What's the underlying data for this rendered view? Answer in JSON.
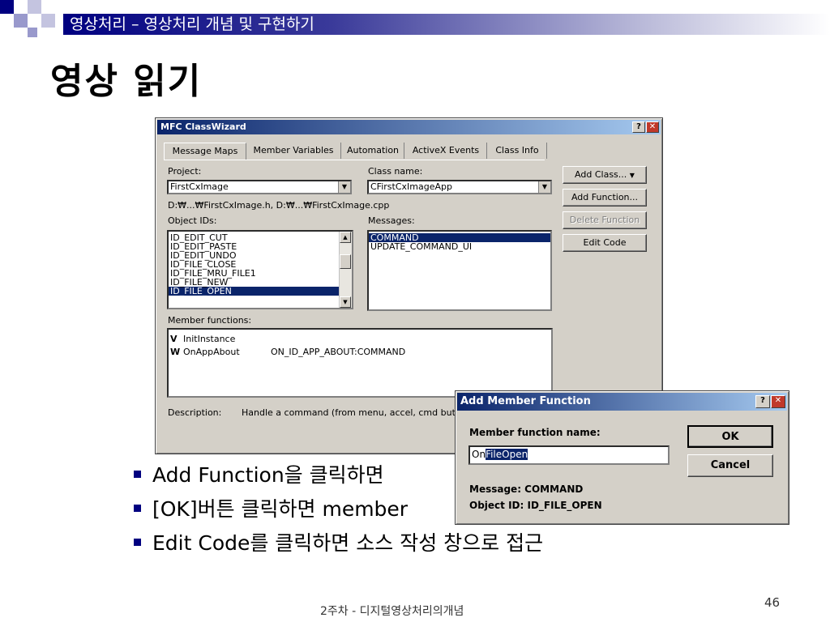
{
  "slide": {
    "header": "영상처리 – 영상처리 개념 및 구현하기",
    "title": "영상 읽기",
    "footer": "2주차 - 디지털영상처리의개념",
    "page_number": "46"
  },
  "classwizard": {
    "title": "MFC ClassWizard",
    "help_btn": "?",
    "close_btn": "✕",
    "tabs": [
      "Message Maps",
      "Member Variables",
      "Automation",
      "ActiveX Events",
      "Class Info"
    ],
    "project_label": "Project:",
    "project_value": "FirstCxImage",
    "class_label": "Class name:",
    "class_value": "CFirstCxImageApp",
    "path_text": "D:₩...₩FirstCxImage.h, D:₩...₩FirstCxImage.cpp",
    "object_ids_label": "Object IDs:",
    "object_ids": [
      "ID_EDIT_CUT",
      "ID_EDIT_PASTE",
      "ID_EDIT_UNDO",
      "ID_FILE_CLOSE",
      "ID_FILE_MRU_FILE1",
      "ID_FILE_NEW",
      "ID_FILE_OPEN"
    ],
    "messages_label": "Messages:",
    "messages": [
      "COMMAND",
      "UPDATE_COMMAND_UI"
    ],
    "member_functions_label": "Member functions:",
    "member_functions": [
      {
        "flag": "V",
        "name": "InitInstance",
        "map": ""
      },
      {
        "flag": "W",
        "name": "OnAppAbout",
        "map": "ON_ID_APP_ABOUT:COMMAND"
      }
    ],
    "description_label": "Description:",
    "description_text": "Handle a command (from menu, accel, cmd butto",
    "buttons": {
      "add_class": "Add Class...",
      "add_function": "Add Function...",
      "delete_function": "Delete Function",
      "edit_code": "Edit Code"
    }
  },
  "addmember": {
    "title": "Add Member Function",
    "help_btn": "?",
    "close_btn": "✕",
    "name_label": "Member function name:",
    "name_prefix": "On",
    "name_selected": "FileOpen",
    "ok": "OK",
    "cancel": "Cancel",
    "message": "Message: COMMAND",
    "object_id": "Object ID: ID_FILE_OPEN"
  },
  "bullets": [
    "Add Function을 클릭하면",
    "[OK]버튼 클릭하면 member",
    "Edit Code를 클릭하면 소스 작성 창으로 접근"
  ],
  "colors": {
    "navy": "#000080",
    "selection": "#0a246a",
    "window_face": "#d4d0c8"
  }
}
